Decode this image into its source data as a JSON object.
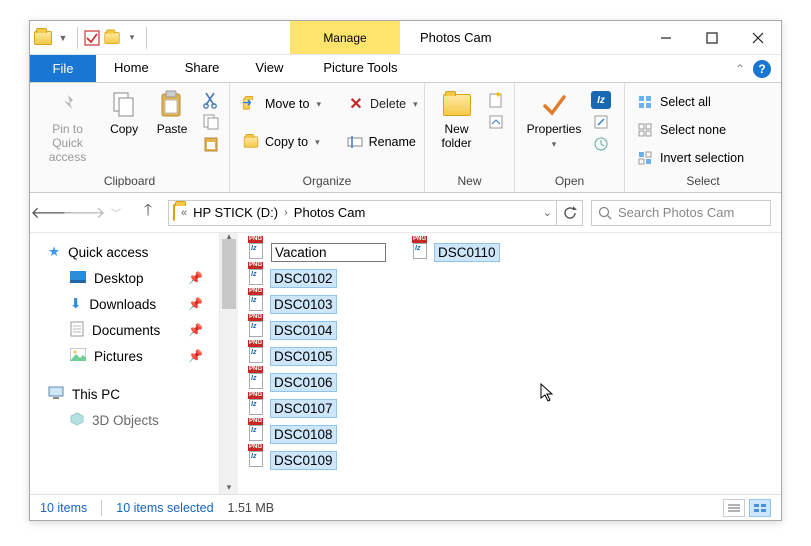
{
  "titlebar": {
    "manage": "Manage",
    "title": "Photos Cam"
  },
  "menu": {
    "file": "File",
    "home": "Home",
    "share": "Share",
    "view": "View",
    "picture_tools": "Picture Tools"
  },
  "ribbon": {
    "clipboard": {
      "label": "Clipboard",
      "pin": "Pin to Quick access",
      "copy": "Copy",
      "paste": "Paste"
    },
    "organize": {
      "label": "Organize",
      "moveto": "Move to",
      "copyto": "Copy to",
      "delete": "Delete",
      "rename": "Rename"
    },
    "new": {
      "label": "New",
      "newfolder": "New folder"
    },
    "open": {
      "label": "Open",
      "properties": "Properties"
    },
    "select": {
      "label": "Select",
      "all": "Select all",
      "none": "Select none",
      "invert": "Invert selection"
    }
  },
  "address": {
    "seg1": "HP STICK (D:)",
    "seg2": "Photos Cam",
    "search_placeholder": "Search Photos Cam"
  },
  "nav": {
    "quick": "Quick access",
    "desktop": "Desktop",
    "downloads": "Downloads",
    "documents": "Documents",
    "pictures": "Pictures",
    "thispc": "This PC",
    "obj3d": "3D Objects"
  },
  "files": {
    "rename_value": "Vacation",
    "col1": [
      "DSC0102",
      "DSC0103",
      "DSC0104",
      "DSC0105",
      "DSC0106",
      "DSC0107",
      "DSC0108"
    ],
    "col2": [
      "DSC0109",
      "DSC0110"
    ]
  },
  "status": {
    "items": "10 items",
    "selected": "10 items selected",
    "size": "1.51 MB"
  }
}
